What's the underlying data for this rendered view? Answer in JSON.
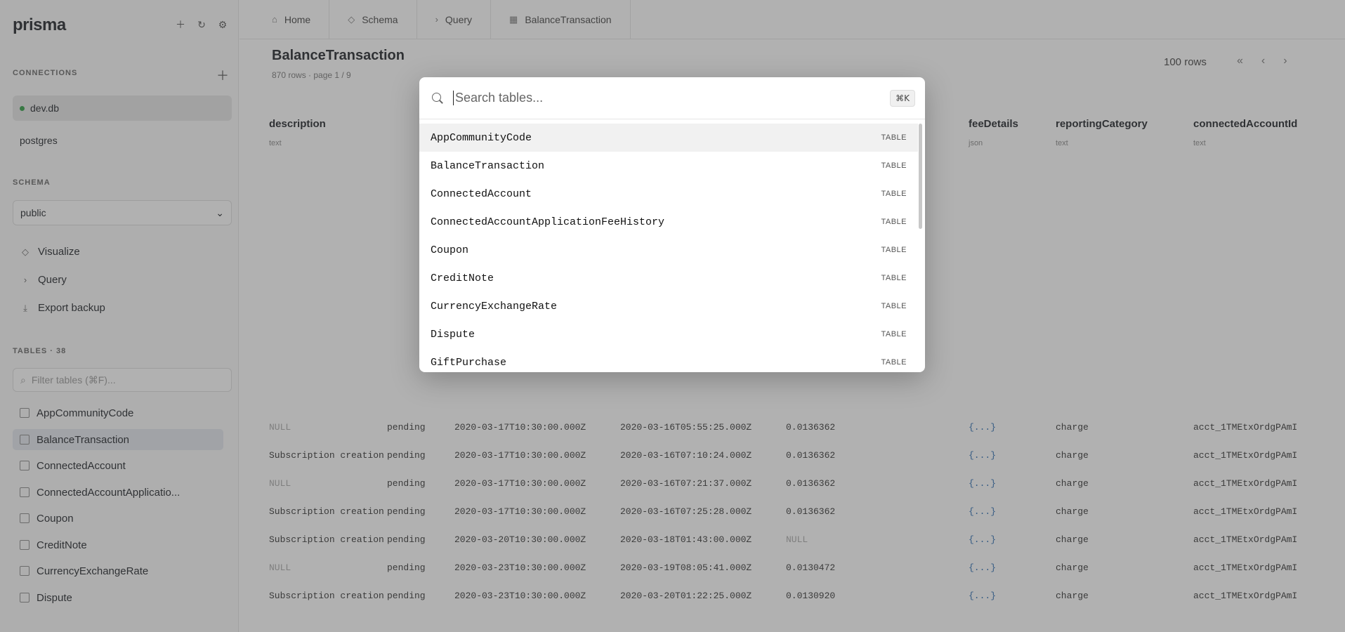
{
  "app": {
    "brand": "prisma",
    "sections": {
      "connections": "CONNECTIONS",
      "schema": "SCHEMA",
      "tables": "TABLES · 38"
    },
    "connections": [
      "dev.db",
      "postgres"
    ],
    "schema_value": "public",
    "nav": [
      "Visualize",
      "Query",
      "Export backup"
    ],
    "filter_placeholder": "Filter tables (⌘F)...",
    "tables": [
      "AppCommunityCode",
      "BalanceTransaction",
      "ConnectedAccount",
      "ConnectedAccountApplicatio...",
      "Coupon",
      "CreditNote",
      "CurrencyExchangeRate",
      "Dispute"
    ]
  },
  "tabs": [
    "Home",
    "Schema",
    "Query",
    "BalanceTransaction"
  ],
  "table_view": {
    "title": "BalanceTransaction",
    "subtitle": "870 rows · page 1 / 9",
    "rows_badge": "100 rows",
    "columns": [
      {
        "name": "description",
        "type": "text"
      },
      {
        "name": "feeDetails",
        "type": "json"
      },
      {
        "name": "reportingCategory",
        "type": "text"
      },
      {
        "name": "connectedAccountId",
        "type": "text"
      }
    ],
    "rows": [
      [
        "NULL",
        "pending",
        "2020-03-17T10:30:00.000Z",
        "2020-03-16T05:55:25.000Z",
        "0.0136362",
        "{...}",
        "charge",
        "acct_1TMEtxOrdgPAmI"
      ],
      [
        "Subscription creation",
        "pending",
        "2020-03-17T10:30:00.000Z",
        "2020-03-16T07:10:24.000Z",
        "0.0136362",
        "{...}",
        "charge",
        "acct_1TMEtxOrdgPAmI"
      ],
      [
        "NULL",
        "pending",
        "2020-03-17T10:30:00.000Z",
        "2020-03-16T07:21:37.000Z",
        "0.0136362",
        "{...}",
        "charge",
        "acct_1TMEtxOrdgPAmI"
      ],
      [
        "Subscription creation",
        "pending",
        "2020-03-17T10:30:00.000Z",
        "2020-03-16T07:25:28.000Z",
        "0.0136362",
        "{...}",
        "charge",
        "acct_1TMEtxOrdgPAmI"
      ],
      [
        "Subscription creation",
        "pending",
        "2020-03-20T10:30:00.000Z",
        "2020-03-18T01:43:00.000Z",
        "NULL",
        "{...}",
        "charge",
        "acct_1TMEtxOrdgPAmI"
      ],
      [
        "NULL",
        "pending",
        "2020-03-23T10:30:00.000Z",
        "2020-03-19T08:05:41.000Z",
        "0.0130472",
        "{...}",
        "charge",
        "acct_1TMEtxOrdgPAmI"
      ],
      [
        "Subscription creation",
        "pending",
        "2020-03-23T10:30:00.000Z",
        "2020-03-20T01:22:25.000Z",
        "0.0130920",
        "{...}",
        "charge",
        "acct_1TMEtxOrdgPAmI"
      ]
    ]
  },
  "modal": {
    "search_placeholder": "Search tables...",
    "shortcut": "⌘K",
    "items": [
      {
        "name": "AppCommunityCode",
        "kind": "TABLE"
      },
      {
        "name": "BalanceTransaction",
        "kind": "TABLE"
      },
      {
        "name": "ConnectedAccount",
        "kind": "TABLE"
      },
      {
        "name": "ConnectedAccountApplicationFeeHistory",
        "kind": "TABLE"
      },
      {
        "name": "Coupon",
        "kind": "TABLE"
      },
      {
        "name": "CreditNote",
        "kind": "TABLE"
      },
      {
        "name": "CurrencyExchangeRate",
        "kind": "TABLE"
      },
      {
        "name": "Dispute",
        "kind": "TABLE"
      },
      {
        "name": "GiftPurchase",
        "kind": "TABLE"
      }
    ]
  }
}
